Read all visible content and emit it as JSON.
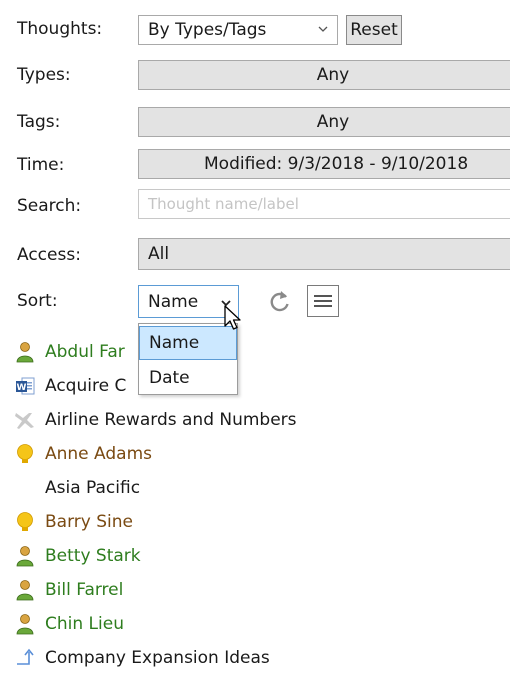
{
  "filters": {
    "thoughts_label": "Thoughts:",
    "thoughts_value": "By Types/Tags",
    "reset_label": "Reset",
    "types_label": "Types:",
    "types_value": "Any",
    "tags_label": "Tags:",
    "tags_value": "Any",
    "time_label": "Time:",
    "time_value": "Modified: 9/3/2018 - 9/10/2018",
    "search_label": "Search:",
    "search_placeholder": "Thought name/label",
    "access_label": "Access:",
    "access_value": "All",
    "sort_label": "Sort:",
    "sort_value": "Name"
  },
  "sort_dropdown": {
    "options": [
      "Name",
      "Date"
    ],
    "highlighted": "Name"
  },
  "thoughts": [
    {
      "label": "Abdul Far",
      "icon": "person-icon",
      "color": "#2e7d1e"
    },
    {
      "label": "Acquire C",
      "icon": "word-document-icon",
      "color": "#1a1a1a"
    },
    {
      "label": "Airline Rewards and Numbers",
      "icon": "airplane-icon",
      "color": "#1a1a1a"
    },
    {
      "label": "Anne Adams",
      "icon": "yellow-bulb-icon",
      "color": "#7a4a12"
    },
    {
      "label": "Asia Pacific",
      "icon": "",
      "color": "#1a1a1a"
    },
    {
      "label": "Barry Sine",
      "icon": "yellow-bulb-icon",
      "color": "#7a4a12"
    },
    {
      "label": "Betty Stark",
      "icon": "person-icon",
      "color": "#2e7d1e"
    },
    {
      "label": "Bill Farrel",
      "icon": "person-icon",
      "color": "#2e7d1e"
    },
    {
      "label": "Chin Lieu",
      "icon": "person-icon",
      "color": "#2e7d1e"
    },
    {
      "label": "Company Expansion Ideas",
      "icon": "link-arrow-icon",
      "color": "#1a1a1a"
    }
  ],
  "colors": {
    "person_text": "#2e7d1e",
    "bulb_text": "#7a4a12",
    "button_bg": "#e3e3e3",
    "focus_border": "#5b9bd5",
    "selected_bg": "#cce8ff"
  }
}
